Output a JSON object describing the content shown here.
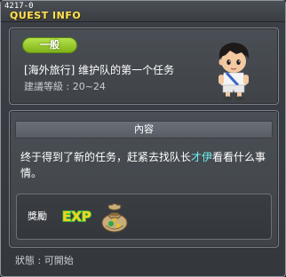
{
  "window": {
    "quest_id": "4217-0",
    "title": "QUEST INFO"
  },
  "quest": {
    "category": "一般",
    "name": "[海外旅行] 维护队的第一个任务",
    "level_req": "建議等級 : 20~24"
  },
  "content": {
    "header": "內容",
    "desc_before": "终于得到了新的任务，赶紧去找队长",
    "desc_npc": "才伊",
    "desc_after": "看看什么事情。"
  },
  "reward": {
    "label": "獎勵",
    "exp_text": "EXP",
    "icon": "exp-bag-icon"
  },
  "status": {
    "text": "狀態 : 可開始"
  },
  "colors": {
    "title": "#ffe259",
    "badge": "#8fc226",
    "npc_highlight": "#6ff0f0",
    "exp_gold": "#f5d21b",
    "exp_green": "#3bd34a"
  }
}
